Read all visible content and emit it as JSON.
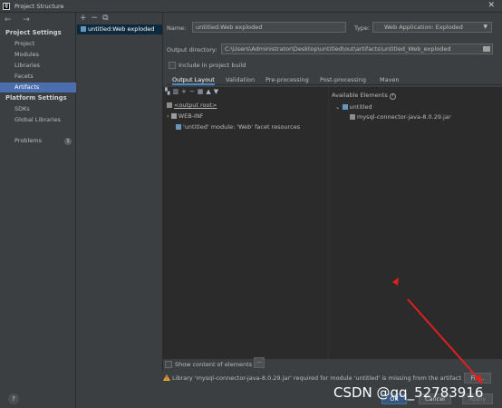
{
  "window": {
    "title": "Project Structure",
    "app_icon_text": "IJ"
  },
  "left_nav": {
    "nav_arrows": "← →",
    "project_settings_title": "Project Settings",
    "project_settings_items": [
      "Project",
      "Modules",
      "Libraries",
      "Facets",
      "Artifacts"
    ],
    "selected": "Artifacts",
    "platform_settings_title": "Platform Settings",
    "platform_settings_items": [
      "SDKs",
      "Global Libraries"
    ],
    "problems_label": "Problems",
    "problems_count": "1",
    "help_label": "?"
  },
  "artifacts_list": {
    "toolbar": {
      "add": "+",
      "remove": "−",
      "copy": "⧉"
    },
    "items": [
      "untitled:Web exploded"
    ]
  },
  "artifact_form": {
    "name_label": "Name:",
    "name_value": "untitled:Web exploded",
    "type_label": "Type:",
    "type_value": "Web Application: Exploded",
    "output_dir_label": "Output directory:",
    "output_dir_value": "C:\\Users\\Administrator\\Desktop\\untitled\\out\\artifacts\\untitled_Web_exploded",
    "include_in_build_label": "Include in project build",
    "include_in_build_checked": false
  },
  "tabs": [
    "Output Layout",
    "Validation",
    "Pre-processing",
    "Post-processing",
    "Maven"
  ],
  "selected_tab": "Output Layout",
  "output_layout": {
    "root": "<output root>",
    "children": [
      "WEB-INF",
      "'untitled' module: 'Web' facet resources"
    ]
  },
  "available_elements": {
    "title": "Available Elements",
    "help": "?",
    "module": "untitled",
    "libraries": [
      "mysql-connector-java-8.0.29.jar"
    ]
  },
  "show_content_label": "Show content of elements",
  "show_content_checked": false,
  "dots_button_label": "...",
  "warning": {
    "text": "Library 'mysql-connector-java-8.0.29.jar' required for module 'untitled' is missing from the artifact",
    "fix_label": "Fix..."
  },
  "buttons": {
    "ok": "OK",
    "cancel": "Cancel",
    "apply": "Apply"
  },
  "watermark": "CSDN @qq_52783916",
  "colors": {
    "selection": "#4b6eaf",
    "annotation_arrow": "#e02020"
  }
}
